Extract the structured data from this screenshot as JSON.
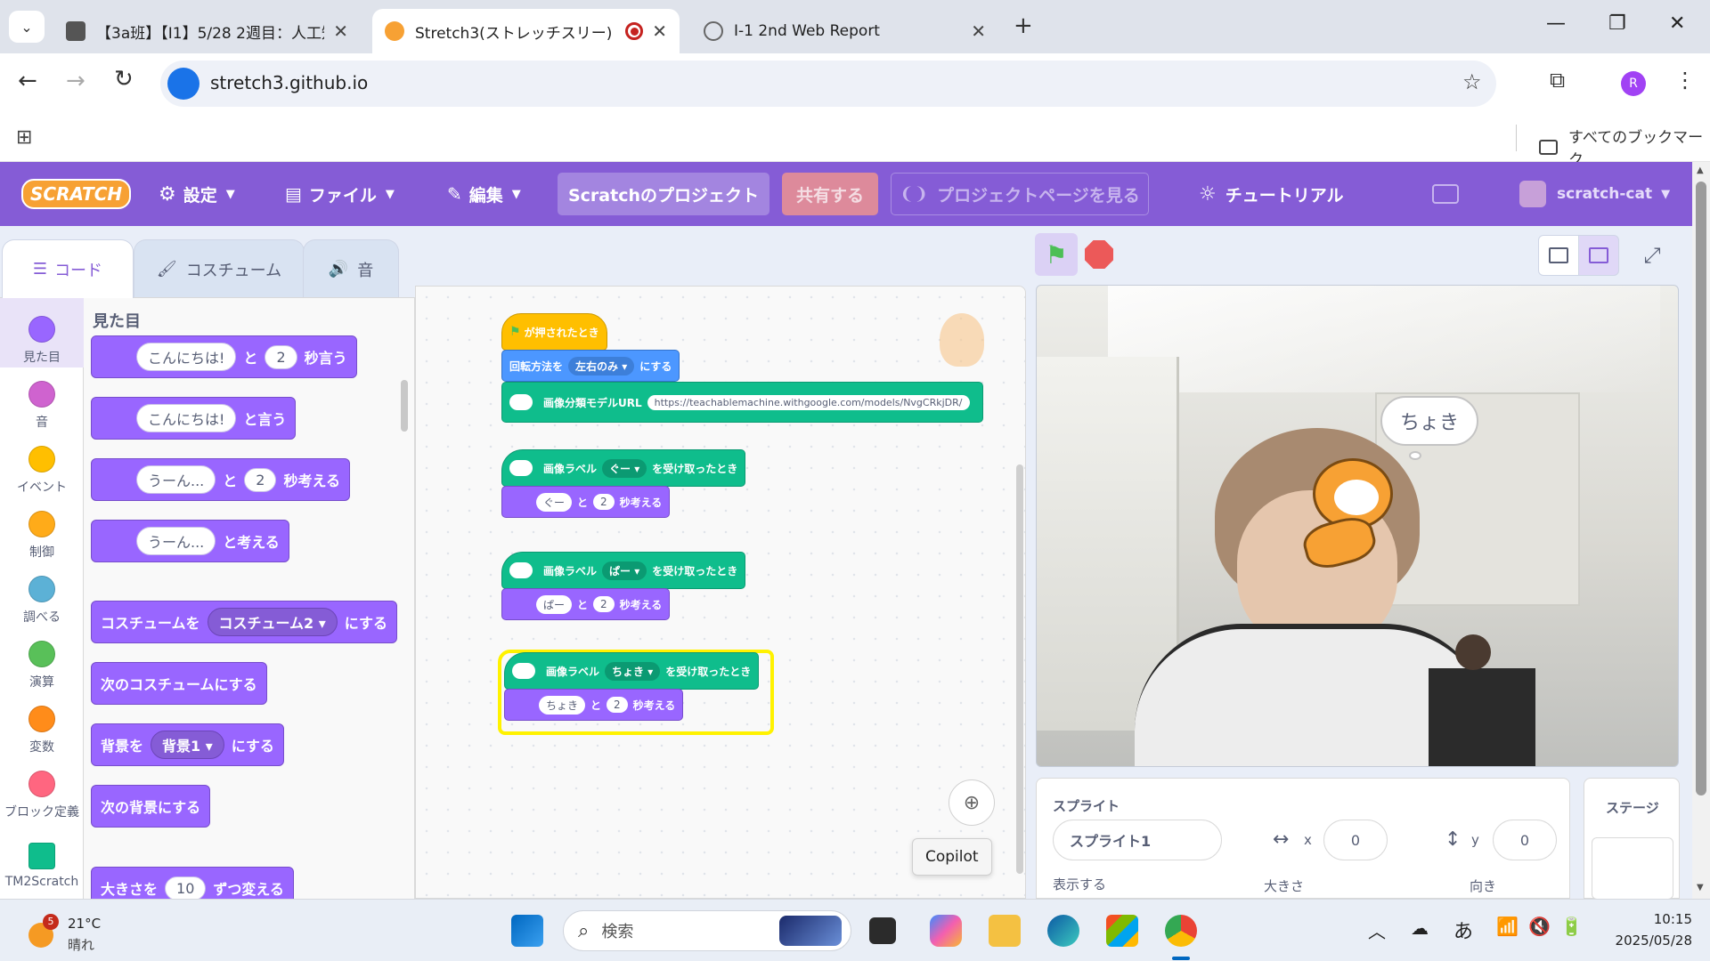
{
  "browser": {
    "tabs": [
      {
        "title": "【3a班】【I1】5/28 2週目：人工知"
      },
      {
        "title": "Stretch3(ストレッチスリー)"
      },
      {
        "title": "I-1 2nd Web Report"
      }
    ],
    "url": "stretch3.github.io",
    "profile_initial": "R",
    "bookmarks_label": "すべてのブックマーク"
  },
  "menubar": {
    "logo": "SCRATCH",
    "settings": "設定",
    "file": "ファイル",
    "edit": "編集",
    "project_title": "Scratchのプロジェクト",
    "share": "共有する",
    "project_page": "プロジェクトページを見る",
    "tutorials": "チュートリアル",
    "username": "scratch-cat",
    "accent_color": "#855cd6"
  },
  "editor_tabs": {
    "code": "コード",
    "costumes": "コスチューム",
    "sounds": "音"
  },
  "categories": [
    {
      "label": "見た目",
      "color": "#9966ff"
    },
    {
      "label": "音",
      "color": "#cf63cf"
    },
    {
      "label": "イベント",
      "color": "#ffbf00"
    },
    {
      "label": "制御",
      "color": "#ffab19"
    },
    {
      "label": "調べる",
      "color": "#5cb1d6"
    },
    {
      "label": "演算",
      "color": "#59c059"
    },
    {
      "label": "変数",
      "color": "#ff8c1a"
    },
    {
      "label": "ブロック定義",
      "color": "#ff6680"
    },
    {
      "label": "TM2Scratch",
      "color": "#0fbd8c"
    }
  ],
  "palette": {
    "heading": "見た目",
    "b1": {
      "text": "こんにちは!",
      "mid": "と",
      "num": "2",
      "tail": "秒言う"
    },
    "b2": {
      "text": "こんにちは!",
      "tail": "と言う"
    },
    "b3": {
      "text": "うーん...",
      "mid": "と",
      "num": "2",
      "tail": "秒考える"
    },
    "b4": {
      "text": "うーん...",
      "tail": "と考える"
    },
    "b5": {
      "head": "コスチュームを",
      "drop": "コスチューム2",
      "tail": "にする"
    },
    "b6": {
      "text": "次のコスチュームにする"
    },
    "b7": {
      "head": "背景を",
      "drop": "背景1",
      "tail": "にする"
    },
    "b8": {
      "text": "次の背景にする"
    },
    "b9": {
      "head": "大きさを",
      "num": "10",
      "tail": "ずつ変える"
    }
  },
  "script": {
    "hat": "が押されたとき",
    "rotation": {
      "head": "回転方法を",
      "drop": "左右のみ",
      "tail": "にする"
    },
    "model": {
      "head": "画像分類モデルURL",
      "url": "https://teachablemachine.withgoogle.com/models/NvgCRkjDR/"
    },
    "groups": [
      {
        "head": "画像ラベル",
        "label": "ぐー",
        "tail": "を受け取ったとき",
        "think": "ぐー",
        "mid": "と",
        "num": "2",
        "end": "秒考える"
      },
      {
        "head": "画像ラベル",
        "label": "ぱー",
        "tail": "を受け取ったとき",
        "think": "ぱー",
        "mid": "と",
        "num": "2",
        "end": "秒考える"
      },
      {
        "head": "画像ラベル",
        "label": "ちょき",
        "tail": "を受け取ったとき",
        "think": "ちょき",
        "mid": "と",
        "num": "2",
        "end": "秒考える"
      }
    ]
  },
  "stage": {
    "bubble": "ちょき"
  },
  "sprite_info": {
    "sprite_label": "スプライト",
    "sprite_name": "スプライト1",
    "x_label": "x",
    "x": "0",
    "y_label": "y",
    "y": "0",
    "show_label": "表示する",
    "size_label": "大きさ",
    "direction_label": "向き",
    "stage_label": "ステージ"
  },
  "tooltip": "Copilot",
  "taskbar": {
    "badge": "5",
    "temperature": "21°C",
    "weather": "晴れ",
    "search_placeholder": "検索",
    "ime": "あ",
    "time": "10:15",
    "date": "2025/05/28"
  }
}
